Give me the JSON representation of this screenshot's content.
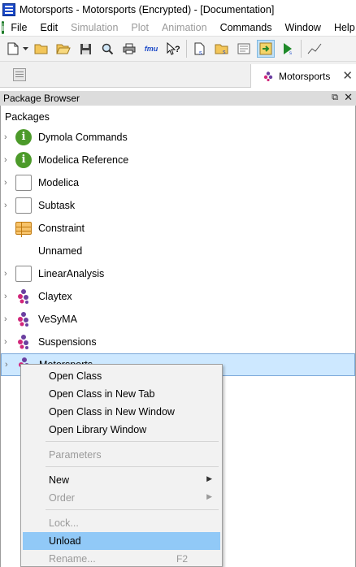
{
  "window": {
    "title": "Motorsports - Motorsports  (Encrypted) - [Documentation]"
  },
  "menubar": {
    "items": [
      {
        "label": "File",
        "enabled": true
      },
      {
        "label": "Edit",
        "enabled": true
      },
      {
        "label": "Simulation",
        "enabled": false
      },
      {
        "label": "Plot",
        "enabled": false
      },
      {
        "label": "Animation",
        "enabled": false
      },
      {
        "label": "Commands",
        "enabled": true
      },
      {
        "label": "Window",
        "enabled": true
      },
      {
        "label": "Help",
        "enabled": true
      }
    ]
  },
  "toolbar": {
    "buttons": [
      "new-icon",
      "dropdown-arrow-icon",
      "open-icon",
      "open-folder-icon",
      "save-icon",
      "search-icon",
      "print-icon",
      "fmu-icon",
      "help-cursor-icon",
      "new-library-icon",
      "open-library-icon",
      "documentation-icon",
      "load-icon",
      "simulate-icon",
      "plot-icon"
    ],
    "fmu_text": "fmu",
    "accent": "#bfe0f7"
  },
  "document_tab": {
    "label": "Motorsports"
  },
  "package_browser": {
    "title": "Package Browser",
    "root_label": "Packages",
    "rows": [
      {
        "label": "Dymola Commands",
        "icon": "info-icon",
        "expandable": true
      },
      {
        "label": "Modelica Reference",
        "icon": "info-icon",
        "expandable": true
      },
      {
        "label": "Modelica",
        "icon": "package-icon",
        "expandable": true
      },
      {
        "label": "Subtask",
        "icon": "package-icon",
        "expandable": true
      },
      {
        "label": "Constraint",
        "icon": "table-icon",
        "expandable": false
      },
      {
        "label": "Unnamed",
        "icon": "none",
        "expandable": false
      },
      {
        "label": "LinearAnalysis",
        "icon": "package-icon",
        "expandable": true
      },
      {
        "label": "Claytex",
        "icon": "claytex-icon",
        "expandable": true
      },
      {
        "label": "VeSyMA",
        "icon": "claytex-icon",
        "expandable": true
      },
      {
        "label": "Suspensions",
        "icon": "claytex-icon",
        "expandable": true
      },
      {
        "label": "Motorsports",
        "icon": "claytex-icon",
        "expandable": true,
        "selected": true
      }
    ]
  },
  "context_menu": {
    "items": [
      {
        "label": "Open Class",
        "enabled": true
      },
      {
        "label": "Open Class in New Tab",
        "enabled": true
      },
      {
        "label": "Open Class in New Window",
        "enabled": true
      },
      {
        "label": "Open Library Window",
        "enabled": true
      },
      {
        "label": "Parameters",
        "enabled": false
      },
      {
        "label": "New",
        "enabled": true,
        "submenu": true
      },
      {
        "label": "Order",
        "enabled": false,
        "submenu": true
      },
      {
        "label": "Lock...",
        "enabled": false
      },
      {
        "label": "Unload",
        "enabled": true,
        "highlighted": true
      },
      {
        "label": "Rename...",
        "enabled": false,
        "shortcut": "F2"
      }
    ],
    "highlight_color": "#91c9f7"
  }
}
